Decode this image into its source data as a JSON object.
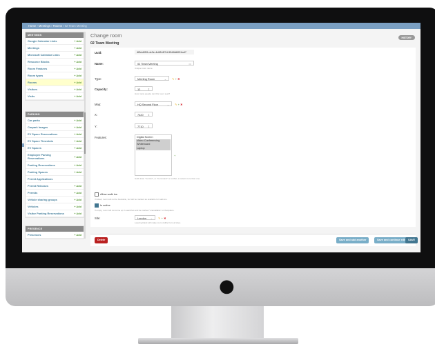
{
  "breadcrumb": {
    "home": "Home",
    "sep": "›",
    "app": "Meetings",
    "model": "Rooms",
    "current": "02 Team Meeting"
  },
  "sidebar": {
    "sections": [
      {
        "title": "MEETINGS",
        "items": [
          {
            "label": "Google Calendar Links",
            "add": "+ Add"
          },
          {
            "label": "Meetings",
            "add": "+ Add"
          },
          {
            "label": "Microsoft Calendar Links",
            "add": "+ Add"
          },
          {
            "label": "Resource Blocks",
            "add": "+ Add"
          },
          {
            "label": "Room Features",
            "add": "+ Add"
          },
          {
            "label": "Room types",
            "add": "+ Add"
          },
          {
            "label": "Rooms",
            "add": "+ Add"
          },
          {
            "label": "Visitors",
            "add": "+ Add"
          },
          {
            "label": "Visits",
            "add": "+ Add"
          }
        ]
      },
      {
        "title": "PARKING",
        "items": [
          {
            "label": "Car parks",
            "add": "+ Add"
          },
          {
            "label": "Carpark Images",
            "add": "+ Add"
          },
          {
            "label": "EV Space Reservations",
            "add": "+ Add"
          },
          {
            "label": "EV Space Timeslots",
            "add": "+ Add"
          },
          {
            "label": "EV Spaces",
            "add": "+ Add"
          },
          {
            "label": "Employee Parking Reservations",
            "add": "+ Add"
          },
          {
            "label": "Parking Reservations",
            "add": "+ Add"
          },
          {
            "label": "Parking Spaces",
            "add": "+ Add"
          },
          {
            "label": "Permit Applications",
            "add": ""
          },
          {
            "label": "Permit Releases",
            "add": "+ Add"
          },
          {
            "label": "Permits",
            "add": "+ Add"
          },
          {
            "label": "Vehicle sharing groups",
            "add": "+ Add"
          },
          {
            "label": "Vehicles",
            "add": "+ Add"
          },
          {
            "label": "Visitor Parking Reservations",
            "add": "+ Add"
          }
        ]
      },
      {
        "title": "PRESENCE",
        "items": [
          {
            "label": "Presences",
            "add": "+ Add"
          }
        ]
      }
    ]
  },
  "page": {
    "title": "Change room",
    "object_name": "02 Team Meeting",
    "history_label": "HISTORY"
  },
  "form": {
    "uuid_label": "Uuid:",
    "uuid_value": "4f5dd059-dc2e-4d65-8f7d-5548d6051a47",
    "name_label": "Name:",
    "name_value": "02 Team Meeting",
    "name_help": "Unique room name.",
    "type_label": "Type:",
    "type_value": "Meeting Room",
    "capacity_label": "Capacity:",
    "capacity_value": "12",
    "capacity_help": "How many people can this room seat?",
    "map_label": "Map:",
    "map_value": "HQ Second Floor",
    "x_label": "X:",
    "x_value": "7420",
    "y_label": "Y:",
    "y_value": "7710",
    "features_label": "Features:",
    "features_options": [
      "Digital Screen",
      "Video Conferencing",
      "Whiteboard",
      "Laptop"
    ],
    "features_help": "Hold down \"Control\", or \"Command\" on a Mac, to select more than one.",
    "walkin_label": "Allow walk ins",
    "walkin_help": "If ticked, room will not be bookable, but will be marked as available for walk-ins.",
    "active_label": "Is active",
    "active_help": "If empty, room will not come up in searches and be marked \"unavailable\" on floorplans.",
    "site_label": "Site:",
    "site_value": "London",
    "site_help": "Leaving blank will make room visible from all sites."
  },
  "buttons": {
    "delete": "Delete",
    "save_add_another": "Save and add another",
    "save_continue": "Save and continue editing",
    "save": "SAVE"
  },
  "colors": {
    "header": "#7a9fc2",
    "link": "#447e9b",
    "delete": "#ba2121",
    "save": "#417690",
    "secondary": "#79aec8"
  }
}
